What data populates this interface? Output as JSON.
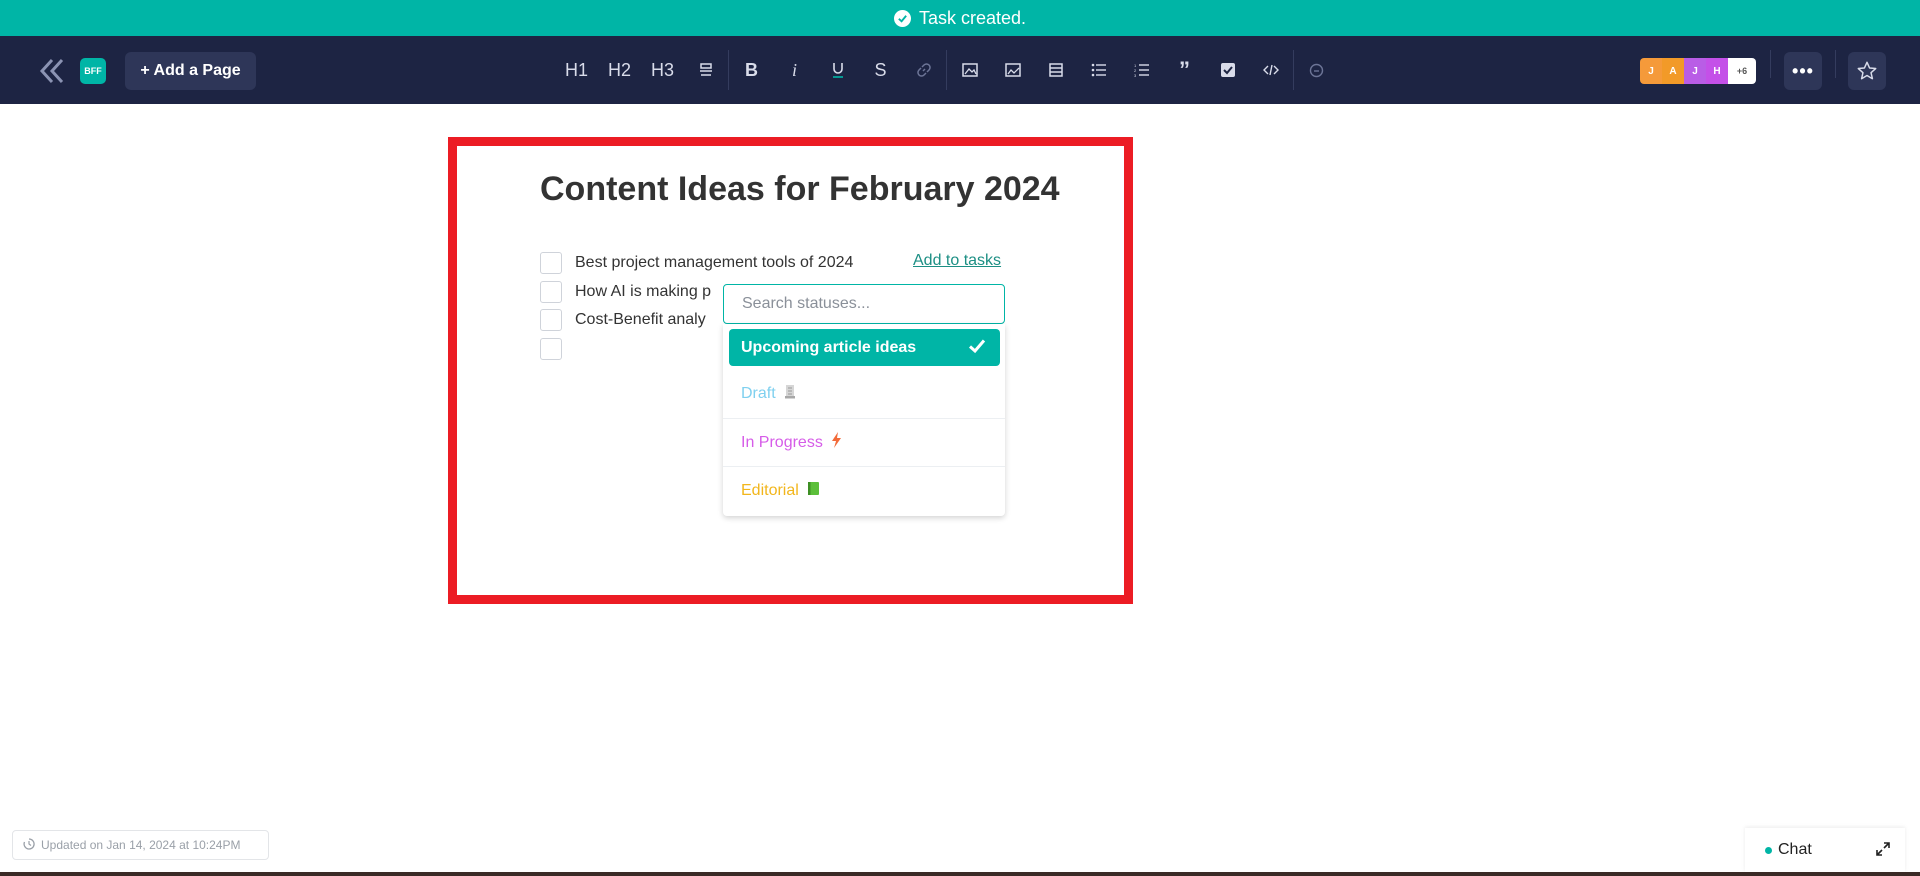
{
  "toast": {
    "message": "Task created."
  },
  "toolbar": {
    "workspace_badge": "BFF",
    "add_page_label": "+ Add a Page",
    "heading_buttons": [
      "H1",
      "H2",
      "H3"
    ],
    "avatars": [
      {
        "initial": "J",
        "color": "#f59a3a"
      },
      {
        "initial": "A",
        "color": "#f29a28"
      },
      {
        "initial": "J",
        "color": "#b95de6"
      },
      {
        "initial": "H",
        "color": "#c450e8"
      }
    ],
    "avatars_more": "+6",
    "more_label": "•••"
  },
  "document": {
    "title": "Content Ideas for February 2024",
    "tasks": [
      "Best project management tools of 2024",
      "How AI is making p",
      "Cost-Benefit analy",
      ""
    ],
    "add_to_tasks_label": "Add to tasks"
  },
  "status_dropdown": {
    "search_placeholder": "Search statuses...",
    "selected": "Upcoming article ideas",
    "options": [
      {
        "label": "Draft",
        "color": "#7fd0ef",
        "icon": "scroll-emoji"
      },
      {
        "label": "In Progress",
        "color": "#d65ce8",
        "icon": "lightning-emoji"
      },
      {
        "label": "Editorial",
        "color": "#f2b61c",
        "icon": "green-book-emoji"
      }
    ]
  },
  "footer": {
    "updated_text": "Updated on Jan 14, 2024 at 10:24PM",
    "chat_label": "Chat"
  },
  "colors": {
    "accent": "#00b5a6",
    "toolbar_bg": "#1d2443",
    "highlight_border": "#ec1c24"
  }
}
